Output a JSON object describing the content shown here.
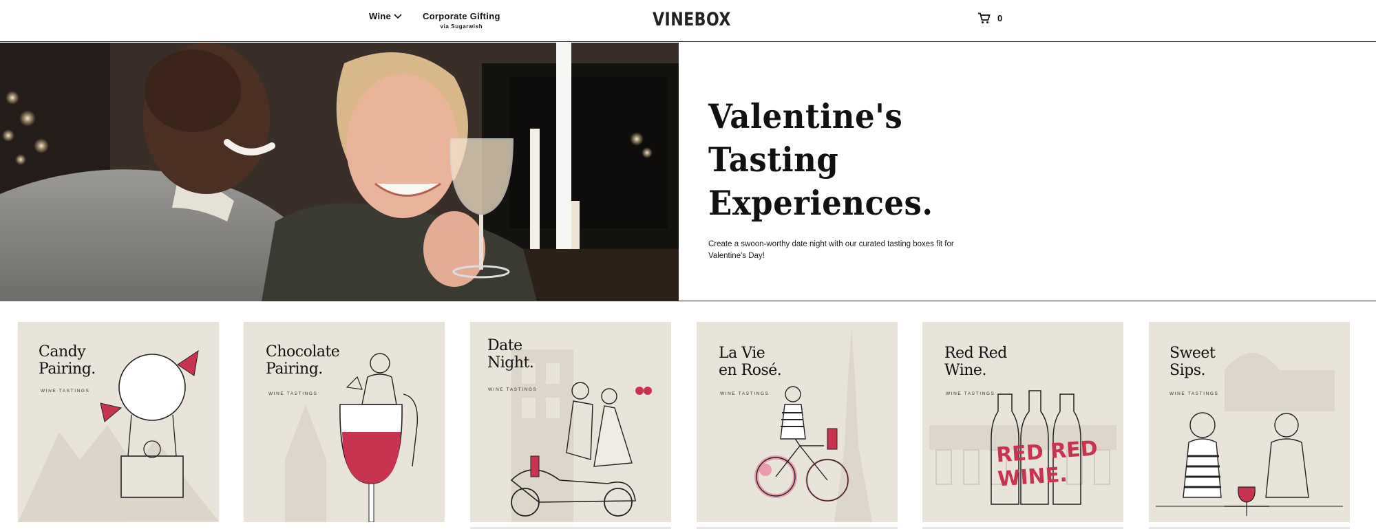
{
  "header": {
    "nav_wine": "Wine",
    "nav_gift": "Corporate Gifting",
    "nav_gift_sub": "via Sugarwish",
    "logo": "VINEBOX",
    "cart_count": "0"
  },
  "hero": {
    "title_line1": "Valentine's",
    "title_line2": "Tasting",
    "title_line3": "Experiences.",
    "description": "Create a swoon-worthy date night with our curated tasting boxes fit for Valentine's Day!"
  },
  "cards": [
    {
      "title1": "Candy",
      "title2": "Pairing.",
      "sub": "WINE TASTINGS"
    },
    {
      "title1": "Chocolate",
      "title2": "Pairing.",
      "sub": "WINE TASTINGS"
    },
    {
      "title1": "Date",
      "title2": "Night.",
      "sub": "WINE TASTINGS"
    },
    {
      "title1": "La Vie",
      "title2": "en Rosé.",
      "sub": "WINE TASTINGS"
    },
    {
      "title1": "Red Red",
      "title2": "Wine.",
      "sub": "WINE TASTINGS"
    },
    {
      "title1": "Sweet",
      "title2": "Sips.",
      "sub": "WINE TASTINGS"
    }
  ],
  "colors": {
    "accent": "#c8334f",
    "card_bg": "#e9e4da",
    "ink": "#111111"
  }
}
